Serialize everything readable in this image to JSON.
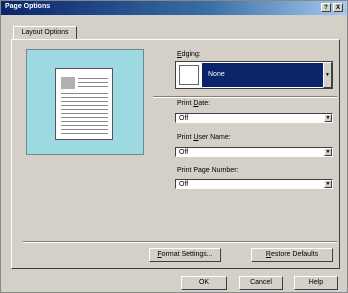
{
  "window": {
    "title": "Page Options",
    "help_glyph": "?",
    "close_glyph": "X"
  },
  "tabs": [
    {
      "label": "Layout Options"
    }
  ],
  "edging": {
    "label_pre": "E",
    "label_rest": "dging:",
    "value": "None"
  },
  "print_date": {
    "label_pre": "Print ",
    "label_u": "D",
    "label_rest": "ate:",
    "value": "Off"
  },
  "print_user": {
    "label_pre": "Print ",
    "label_u": "U",
    "label_rest": "ser Name:",
    "value": "Off"
  },
  "print_page": {
    "label": "Print Page Number:",
    "value": "Off"
  },
  "buttons": {
    "format_u": "F",
    "format_rest": "ormat Settings...",
    "restore_u": "R",
    "restore_rest": "estore Defaults",
    "ok": "OK",
    "cancel": "Cancel",
    "help": "Help"
  },
  "colors": {
    "title_bar": "#0a246a",
    "preview_bg": "#9cd9e0",
    "selection": "#0a246a",
    "dialog_bg": "#d4d0c8"
  }
}
